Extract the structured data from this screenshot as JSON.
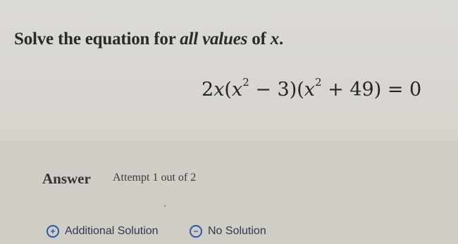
{
  "question": {
    "prompt_prefix": "Solve the equation for ",
    "prompt_emphasis": "all values",
    "prompt_suffix": " of ",
    "prompt_var": "x",
    "prompt_end": ".",
    "equation": {
      "p1": "2",
      "x": "x",
      "p2": "(",
      "p3": " − 3)(",
      "p4": " + 49) = 0",
      "exp": "2"
    }
  },
  "answer": {
    "label": "Answer",
    "attempt": "Attempt 1 out of 2",
    "options": [
      {
        "label": "Additional Solution",
        "icon": "plus-circle-icon",
        "glyph": "+"
      },
      {
        "label": "No Solution",
        "icon": "minus-circle-icon",
        "glyph": "−"
      }
    ],
    "accent_color": "#2c5aa0"
  }
}
